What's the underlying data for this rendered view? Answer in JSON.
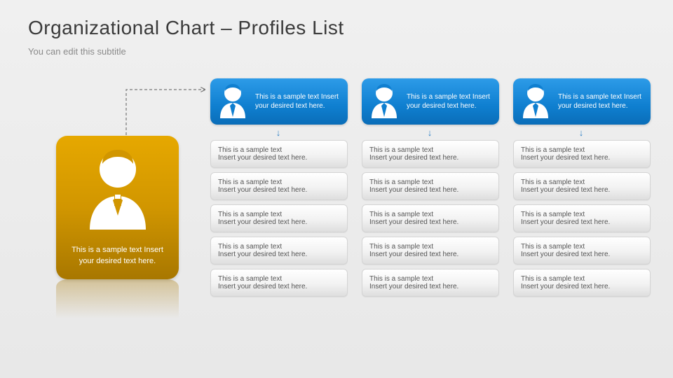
{
  "header": {
    "title": "Organizational Chart – Profiles List",
    "subtitle": "You can edit this subtitle"
  },
  "main": {
    "text": "This is a sample text Insert your desired text here."
  },
  "columns": [
    {
      "head": "This is a sample text Insert your desired text here.",
      "items": [
        {
          "l1": "This is a sample text",
          "l2": "Insert your desired text here."
        },
        {
          "l1": "This is a sample text",
          "l2": "Insert your desired text here."
        },
        {
          "l1": "This is a sample text",
          "l2": "Insert your desired text here."
        },
        {
          "l1": "This is a sample text",
          "l2": "Insert your desired text here."
        },
        {
          "l1": "This is a sample text",
          "l2": "Insert your desired text here."
        }
      ]
    },
    {
      "head": "This is a sample text Insert your desired text here.",
      "items": [
        {
          "l1": "This is a sample text",
          "l2": "Insert your desired text here."
        },
        {
          "l1": "This is a sample text",
          "l2": "Insert your desired text here."
        },
        {
          "l1": "This is a sample text",
          "l2": "Insert your desired text here."
        },
        {
          "l1": "This is a sample text",
          "l2": "Insert your desired text here."
        },
        {
          "l1": "This is a sample text",
          "l2": "Insert your desired text here."
        }
      ]
    },
    {
      "head": "This is a sample text Insert your desired text here.",
      "items": [
        {
          "l1": "This is a sample text",
          "l2": "Insert your desired text here."
        },
        {
          "l1": "This is a sample text",
          "l2": "Insert your desired text here."
        },
        {
          "l1": "This is a sample text",
          "l2": "Insert your desired text here."
        },
        {
          "l1": "This is a sample text",
          "l2": "Insert your desired text here."
        },
        {
          "l1": "This is a sample text",
          "l2": "Insert your desired text here."
        }
      ]
    }
  ],
  "colors": {
    "accentGold": "#d19600",
    "accentBlue": "#0f7fd0"
  }
}
